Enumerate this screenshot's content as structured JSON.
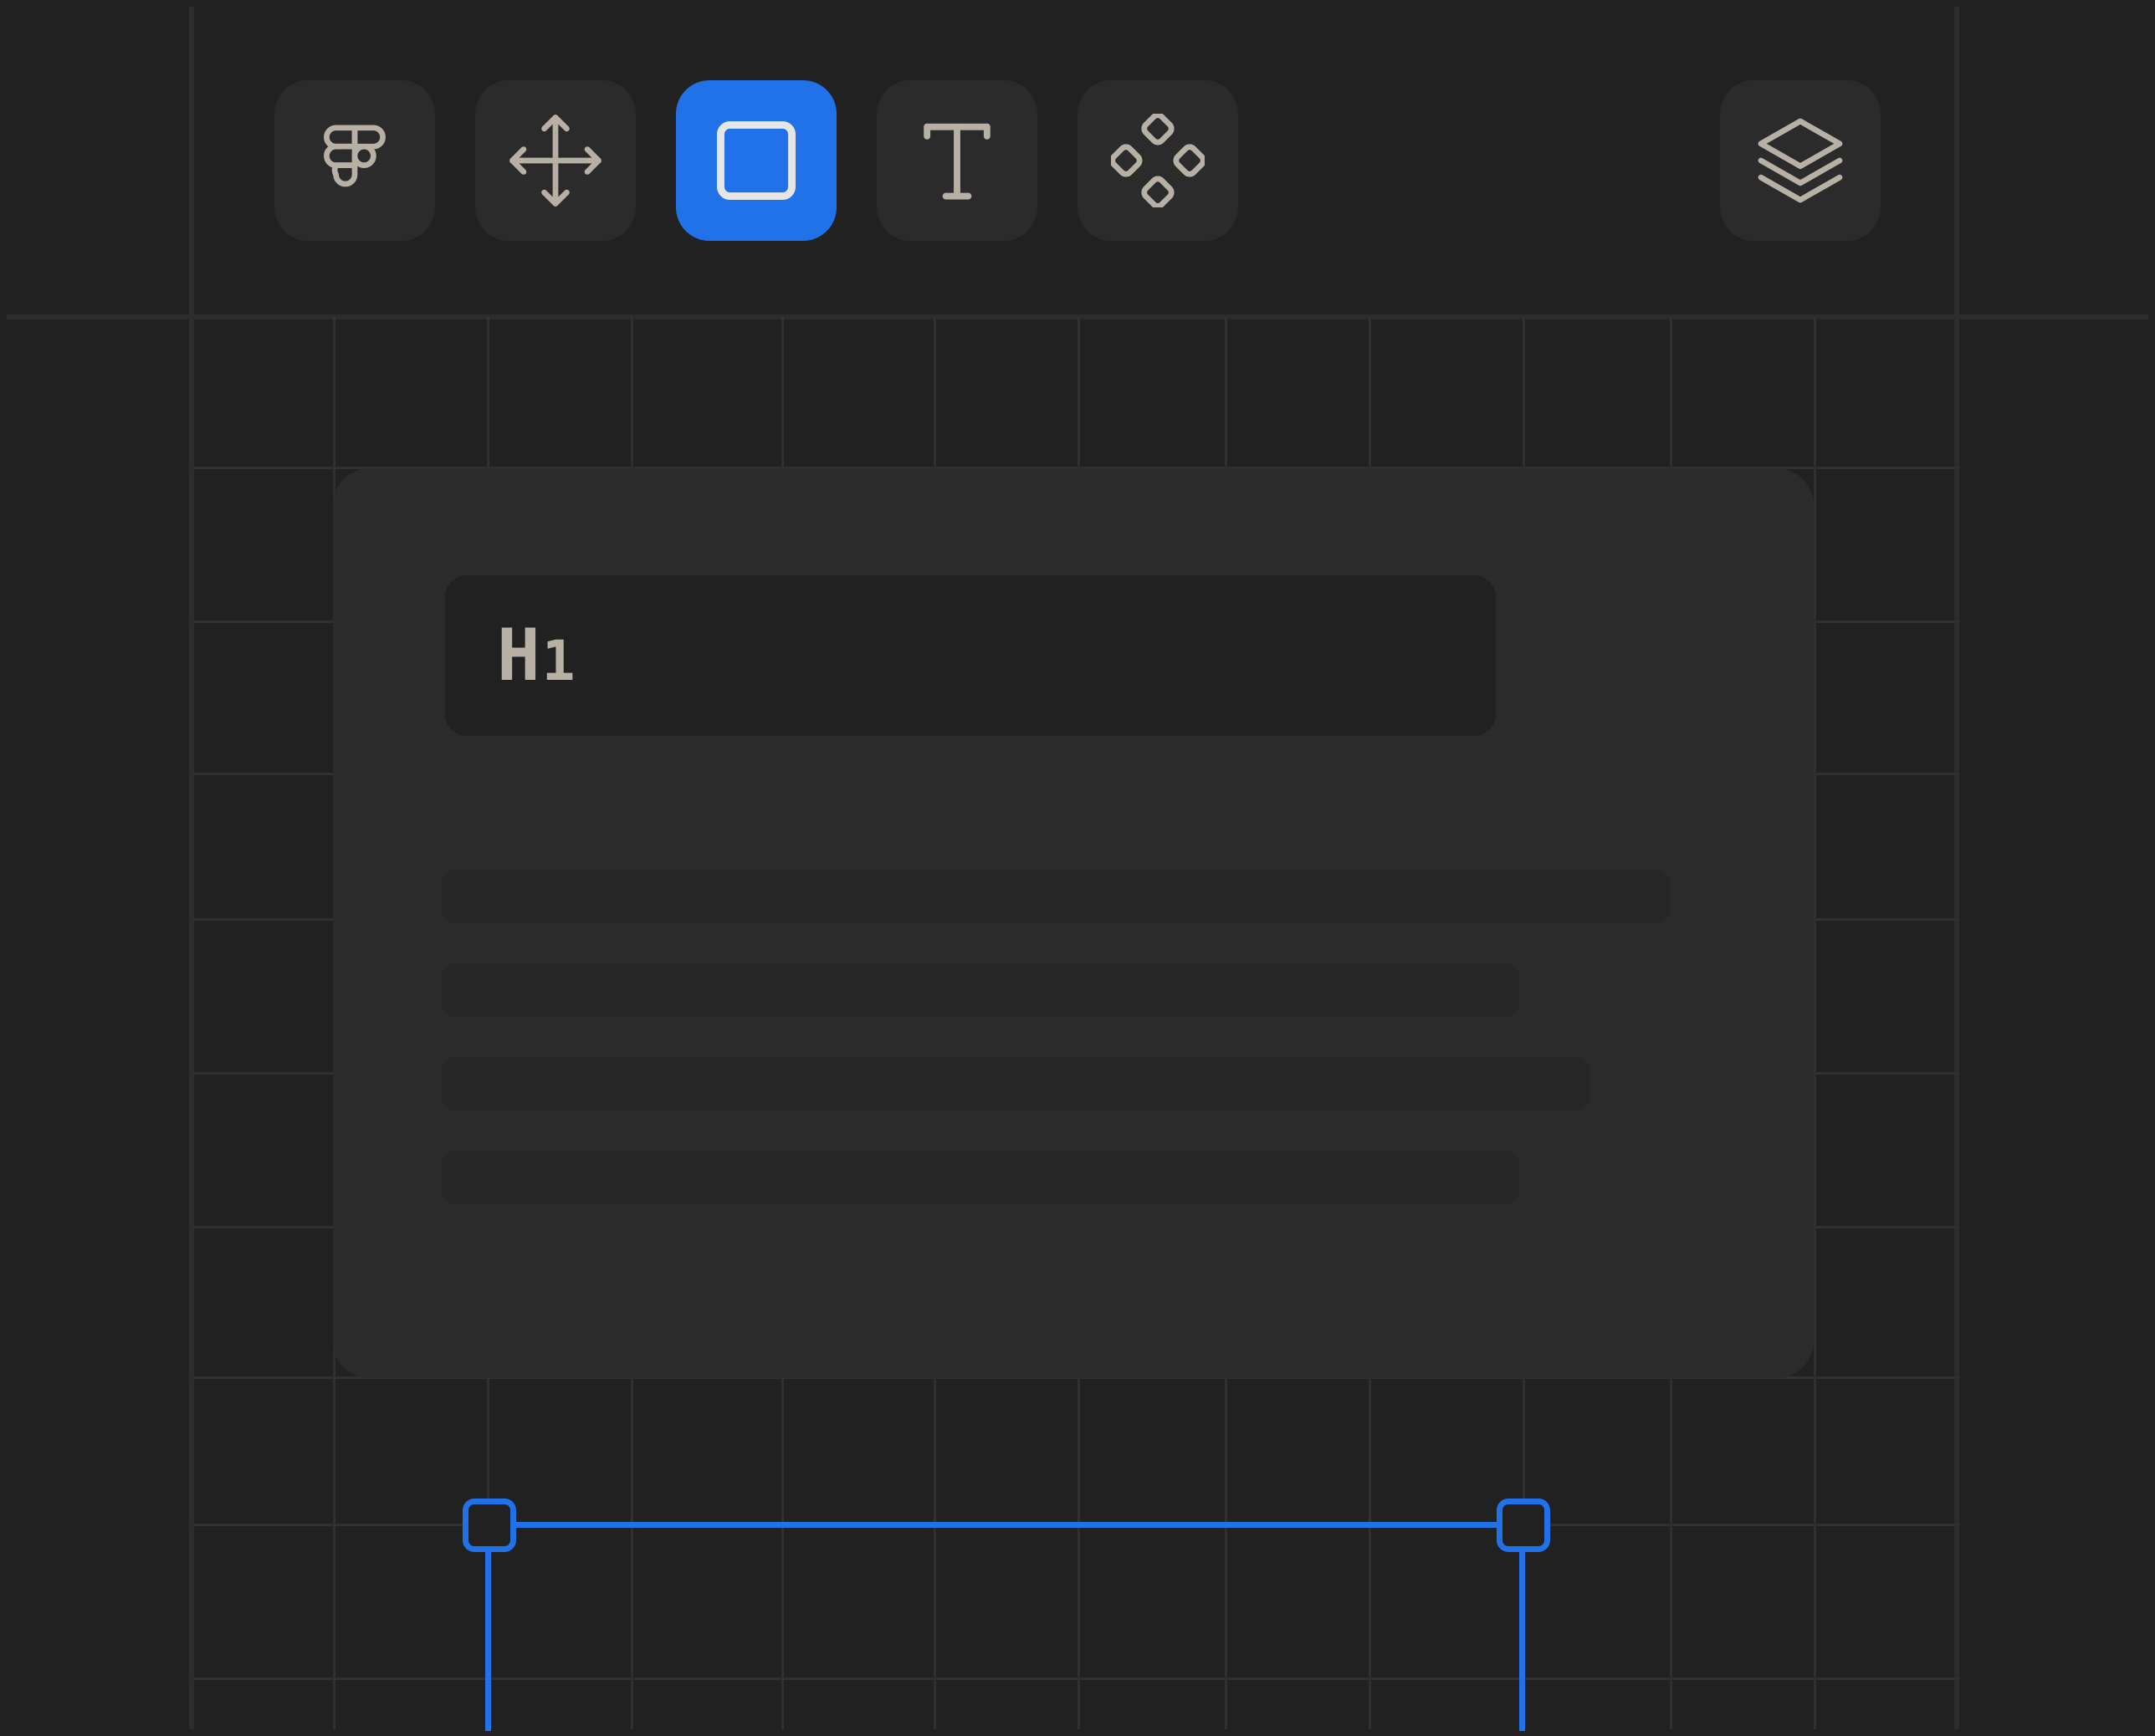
{
  "toolbar": {
    "tools": [
      {
        "name": "figma-logo",
        "icon": "figma-icon",
        "active": false
      },
      {
        "name": "move",
        "icon": "move-icon",
        "active": false
      },
      {
        "name": "frame",
        "icon": "rectangle-icon",
        "active": true
      },
      {
        "name": "text",
        "icon": "text-icon",
        "active": false
      },
      {
        "name": "components",
        "icon": "components-icon",
        "active": false
      }
    ],
    "layers_button": {
      "icon": "layers-icon"
    }
  },
  "card": {
    "heading": {
      "letter": "H",
      "level": "1"
    },
    "placeholder_lines": 4
  },
  "colors": {
    "background": "#212121",
    "surface": "#2b2b2b",
    "accent": "#2172e8",
    "icon": "#b7b1a5"
  }
}
